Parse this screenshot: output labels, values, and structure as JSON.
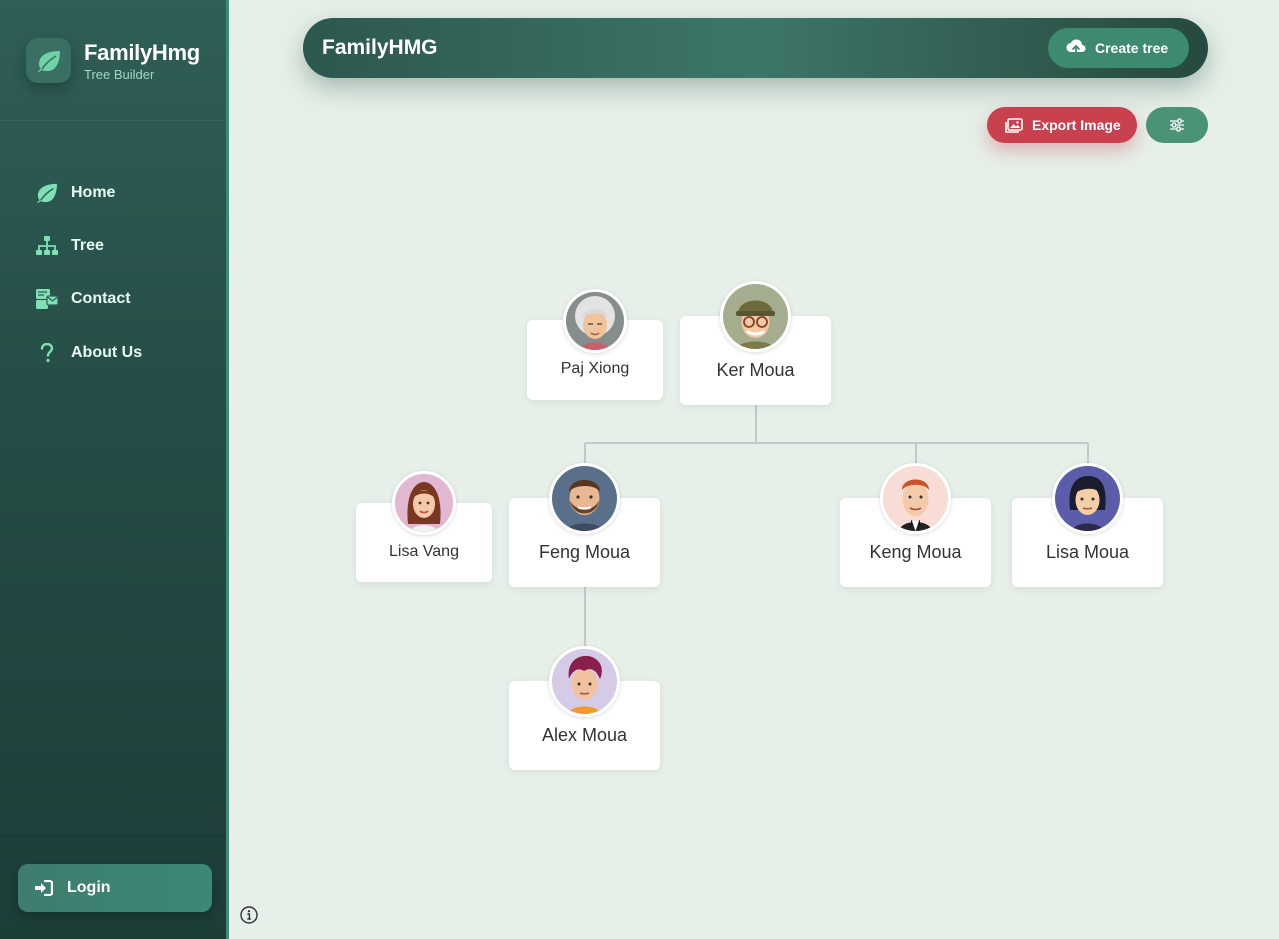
{
  "brand": {
    "title": "FamilyHmg",
    "subtitle": "Tree Builder",
    "icon": "leaf-icon"
  },
  "nav": {
    "items": [
      {
        "label": "Home",
        "icon": "leaf-icon"
      },
      {
        "label": "Tree",
        "icon": "sitemap-icon"
      },
      {
        "label": "Contact",
        "icon": "contact-icon"
      },
      {
        "label": "About Us",
        "icon": "question-icon"
      }
    ]
  },
  "login": {
    "label": "Login",
    "icon": "sign-in-icon"
  },
  "header": {
    "title": "FamilyHMG",
    "create_label": "Create tree"
  },
  "toolbar": {
    "export_label": "Export Image"
  },
  "tree": {
    "people": [
      {
        "id": "paj",
        "name": "Paj Xiong"
      },
      {
        "id": "ker",
        "name": "Ker Moua"
      },
      {
        "id": "lisav",
        "name": "Lisa Vang"
      },
      {
        "id": "feng",
        "name": "Feng Moua"
      },
      {
        "id": "keng",
        "name": "Keng Moua"
      },
      {
        "id": "lisam",
        "name": "Lisa Moua"
      },
      {
        "id": "alex",
        "name": "Alex Moua"
      }
    ]
  },
  "colors": {
    "sidebar": "#2f5f57",
    "accent": "#3e8a6e",
    "export": "#c9404f",
    "background": "#e6f0e8"
  }
}
